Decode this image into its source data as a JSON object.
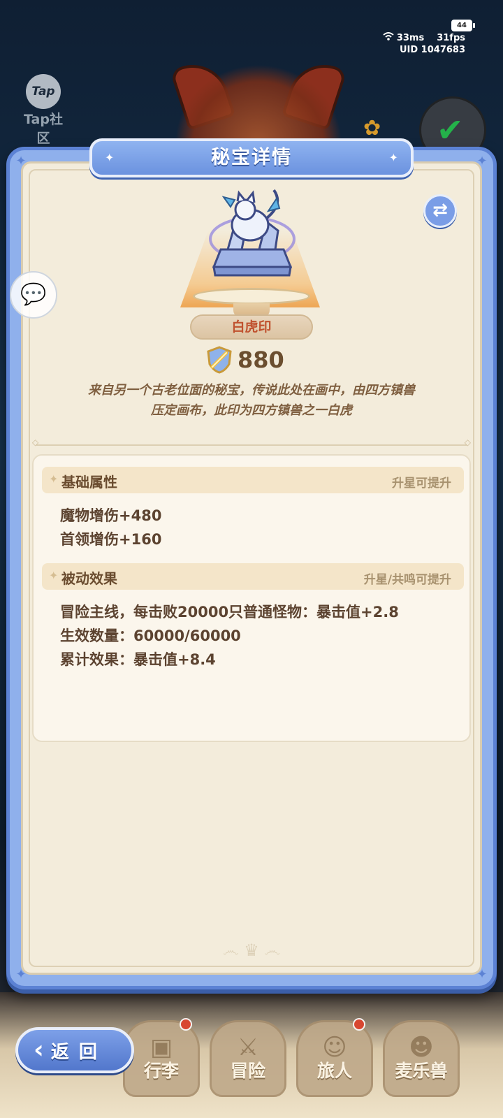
{
  "status_bar": {
    "battery": "44",
    "ping": "33ms",
    "fps": "31fps",
    "uid": "UID 1047683"
  },
  "background": {
    "tap_logo_text": "Tap",
    "tap_label": "Tap社区"
  },
  "modal": {
    "title": "秘宝详情",
    "item_name": "白虎印",
    "power": "880",
    "description_line1": "来自另一个古老位面的秘宝，传说此处在画中，由四方镇兽",
    "description_line2": "压定画布，此印为四方镇兽之一白虎",
    "base_section": {
      "title": "基础属性",
      "hint": "升星可提升",
      "stats": [
        "魔物增伤+480",
        "首领增伤+160"
      ]
    },
    "passive_section": {
      "title": "被动效果",
      "hint": "升星/共鸣可提升",
      "lines": [
        "冒险主线，每击败20000只普通怪物：暴击值+2.8",
        "生效数量：60000/60000",
        "累计效果：暴击值+8.4"
      ]
    }
  },
  "back_button": {
    "label": "返回"
  },
  "bottom_nav": {
    "tabs": [
      "行李",
      "冒险",
      "旅人",
      "麦乐兽"
    ]
  },
  "colors": {
    "frame_blue": "#5c82d4",
    "panel_bg": "#f3ecdb",
    "name_red": "#c0522f",
    "text_brown": "#5c4330"
  }
}
